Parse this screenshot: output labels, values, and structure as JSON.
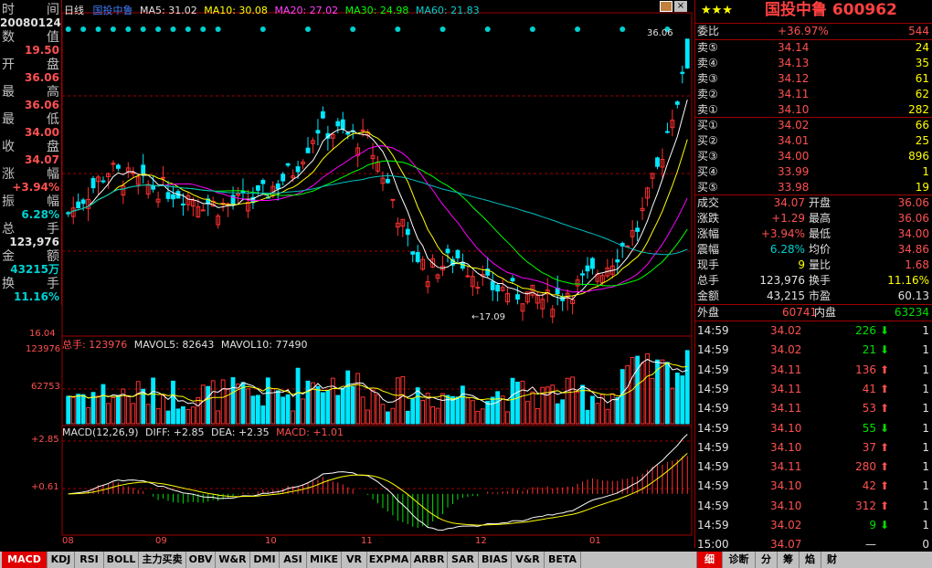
{
  "left_panel": [
    {
      "label_a": "时",
      "label_b": "间",
      "value": "20080124",
      "cls": "white"
    },
    {
      "label_a": "数",
      "label_b": "值",
      "value": "19.50",
      "cls": "red"
    },
    {
      "label_a": "开",
      "label_b": "盘",
      "value": "36.06",
      "cls": "red"
    },
    {
      "label_a": "最",
      "label_b": "高",
      "value": "36.06",
      "cls": "red"
    },
    {
      "label_a": "最",
      "label_b": "低",
      "value": "34.00",
      "cls": "red"
    },
    {
      "label_a": "收",
      "label_b": "盘",
      "value": "34.07",
      "cls": "red"
    },
    {
      "label_a": "涨",
      "label_b": "幅",
      "value": "+3.94%",
      "cls": "red"
    },
    {
      "label_a": "振",
      "label_b": "幅",
      "value": "6.28%",
      "cls": "cyan"
    },
    {
      "label_a": "总",
      "label_b": "手",
      "value": "123,976",
      "cls": "white"
    },
    {
      "label_a": "金",
      "label_b": "额",
      "value": "43215万",
      "cls": "cyan"
    },
    {
      "label_a": "换",
      "label_b": "手",
      "value": "11.16%",
      "cls": "cyan"
    }
  ],
  "main_header": {
    "period": "日线",
    "stock": "国投中鲁",
    "ma5": "MA5: 31.02",
    "ma10": "MA10: 30.08",
    "ma20": "MA20: 27.02",
    "ma30": "MA30: 24.98",
    "ma60": "MA60: 21.83"
  },
  "price_labels": {
    "high_mark": "36.06",
    "low_mark": "17.09",
    "axis_bottom": "16.04"
  },
  "vol_header": {
    "total": "总手: 123976",
    "mavol5": "MAVOL5: 82643",
    "mavol10": "MAVOL10: 77490"
  },
  "vol_axis": {
    "top": "123976",
    "mid": "62753"
  },
  "macd_header": {
    "name": "MACD(12,26,9)",
    "diff": "DIFF: +2.85",
    "dea": "DEA: +2.35",
    "macd": "MACD: +1.01"
  },
  "macd_axis": {
    "top": "+2.85",
    "mid": "+0.61"
  },
  "x_axis": [
    "08",
    "09",
    "10",
    "11",
    "12",
    "01"
  ],
  "colors": {
    "up": "#ff3030",
    "down": "#00e8ff",
    "ma5": "#ffffff",
    "ma10": "#ffff00",
    "ma20": "#ff00ff",
    "ma30": "#00ff00",
    "ma60": "#00c0c0",
    "frame": "#a00000"
  },
  "right_panel": {
    "stars": "★★★",
    "title": "国投中鲁 600962",
    "weibi_label": "委比",
    "weibi_value": "+36.97%",
    "weibi_diff": "544",
    "asks": [
      {
        "label": "卖⑤",
        "price": "34.14",
        "vol": "24"
      },
      {
        "label": "卖④",
        "price": "34.13",
        "vol": "35"
      },
      {
        "label": "卖③",
        "price": "34.12",
        "vol": "61"
      },
      {
        "label": "卖②",
        "price": "34.11",
        "vol": "62"
      },
      {
        "label": "卖①",
        "price": "34.10",
        "vol": "282"
      }
    ],
    "bids": [
      {
        "label": "买①",
        "price": "34.02",
        "vol": "66"
      },
      {
        "label": "买②",
        "price": "34.01",
        "vol": "25"
      },
      {
        "label": "买③",
        "price": "34.00",
        "vol": "896"
      },
      {
        "label": "买④",
        "price": "33.99",
        "vol": "1"
      },
      {
        "label": "买⑤",
        "price": "33.98",
        "vol": "19"
      }
    ],
    "stats": [
      {
        "l1": "成交",
        "v1": "34.07",
        "l2": "开盘",
        "v2": "36.06",
        "c1": "red",
        "c2": "red"
      },
      {
        "l1": "涨跌",
        "v1": "+1.29",
        "l2": "最高",
        "v2": "36.06",
        "c1": "red",
        "c2": "red"
      },
      {
        "l1": "涨幅",
        "v1": "+3.94%",
        "l2": "最低",
        "v2": "34.00",
        "c1": "red",
        "c2": "red"
      },
      {
        "l1": "震幅",
        "v1": "6.28%",
        "l2": "均价",
        "v2": "34.86",
        "c1": "cyan",
        "c2": "red"
      },
      {
        "l1": "现手",
        "v1": "9",
        "l2": "量比",
        "v2": "1.68",
        "c1": "yellow",
        "c2": "red"
      },
      {
        "l1": "总手",
        "v1": "123,976",
        "l2": "换手",
        "v2": "11.16%",
        "c1": "white",
        "c2": "yellow"
      },
      {
        "l1": "金额",
        "v1": "43,215",
        "l2": "市盈",
        "v2": "60.13",
        "c1": "white",
        "c2": "white"
      }
    ],
    "outer_label": "外盘",
    "outer_value": "60741",
    "inner_label": "内盘",
    "inner_value": "63234",
    "ticks": [
      {
        "time": "14:59",
        "price": "34.02",
        "vol": "226",
        "dir": "down",
        "n": "1"
      },
      {
        "time": "14:59",
        "price": "34.02",
        "vol": "21",
        "dir": "down",
        "n": "1"
      },
      {
        "time": "14:59",
        "price": "34.11",
        "vol": "136",
        "dir": "up",
        "n": "1"
      },
      {
        "time": "14:59",
        "price": "34.11",
        "vol": "41",
        "dir": "up",
        "n": "1"
      },
      {
        "time": "14:59",
        "price": "34.11",
        "vol": "53",
        "dir": "up",
        "n": "1"
      },
      {
        "time": "14:59",
        "price": "34.10",
        "vol": "55",
        "dir": "down",
        "n": "1"
      },
      {
        "time": "14:59",
        "price": "34.10",
        "vol": "37",
        "dir": "up",
        "n": "1"
      },
      {
        "time": "14:59",
        "price": "34.11",
        "vol": "280",
        "dir": "up",
        "n": "1"
      },
      {
        "time": "14:59",
        "price": "34.10",
        "vol": "42",
        "dir": "up",
        "n": "1"
      },
      {
        "time": "14:59",
        "price": "34.10",
        "vol": "312",
        "dir": "up",
        "n": "1"
      },
      {
        "time": "14:59",
        "price": "34.02",
        "vol": "9",
        "dir": "down",
        "n": "1"
      },
      {
        "time": "15:00",
        "price": "34.07",
        "vol": "—",
        "dir": "none",
        "n": "0"
      }
    ]
  },
  "bottom_tabs": [
    "MACD",
    "KDJ",
    "RSI",
    "BOLL",
    "主力买卖",
    "OBV",
    "W&R",
    "DMI",
    "ASI",
    "MIKE",
    "VR",
    "EXPMA",
    "ARBR",
    "SAR",
    "BIAS",
    "V&R",
    "BETA"
  ],
  "right_tabs": [
    "细",
    "诊断",
    "分",
    "筹",
    "焰",
    "财"
  ],
  "chart_data": {
    "type": "candlestick",
    "note_x": [
      "08",
      "09",
      "10",
      "11",
      "12",
      "01"
    ],
    "summary": {
      "last_close": 34.07,
      "last_open": 36.06,
      "last_high": 36.06,
      "last_low": 34.0,
      "period_low": 17.09,
      "axis_min": 16.04,
      "axis_max": 36.06
    }
  }
}
